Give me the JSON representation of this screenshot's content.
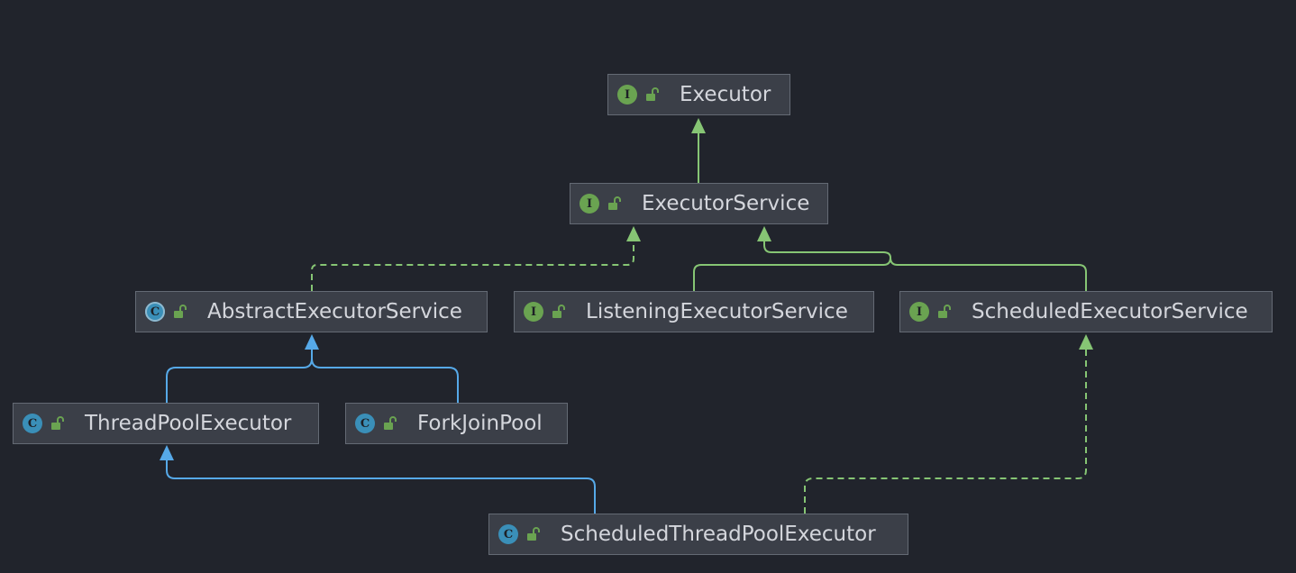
{
  "colors": {
    "background": "#21242c",
    "node_fill": "#3b3f48",
    "node_border": "#646a74",
    "text": "#d4d6dc",
    "interface_badge": "#6aa351",
    "class_badge": "#3a8fb8",
    "extends_arrow": "#56a9e8",
    "interface_arrow": "#86c574"
  },
  "nodes": {
    "executor": {
      "label": "Executor",
      "kind": "interface",
      "badge": "I"
    },
    "executor_service": {
      "label": "ExecutorService",
      "kind": "interface",
      "badge": "I"
    },
    "abstract_executor_service": {
      "label": "AbstractExecutorService",
      "kind": "abstract",
      "badge": "C"
    },
    "listening_executor_service": {
      "label": "ListeningExecutorService",
      "kind": "interface",
      "badge": "I"
    },
    "scheduled_executor_service": {
      "label": "ScheduledExecutorService",
      "kind": "interface",
      "badge": "I"
    },
    "thread_pool_executor": {
      "label": "ThreadPoolExecutor",
      "kind": "class",
      "badge": "C"
    },
    "fork_join_pool": {
      "label": "ForkJoinPool",
      "kind": "class",
      "badge": "C"
    },
    "scheduled_thread_pool_executor": {
      "label": "ScheduledThreadPoolExecutor",
      "kind": "class",
      "badge": "C"
    }
  },
  "edges": [
    {
      "from": "executor_service",
      "to": "executor",
      "type": "extends-interface"
    },
    {
      "from": "abstract_executor_service",
      "to": "executor_service",
      "type": "implements"
    },
    {
      "from": "listening_executor_service",
      "to": "executor_service",
      "type": "extends-interface"
    },
    {
      "from": "scheduled_executor_service",
      "to": "executor_service",
      "type": "extends-interface"
    },
    {
      "from": "thread_pool_executor",
      "to": "abstract_executor_service",
      "type": "extends"
    },
    {
      "from": "fork_join_pool",
      "to": "abstract_executor_service",
      "type": "extends"
    },
    {
      "from": "scheduled_thread_pool_executor",
      "to": "thread_pool_executor",
      "type": "extends"
    },
    {
      "from": "scheduled_thread_pool_executor",
      "to": "scheduled_executor_service",
      "type": "implements"
    }
  ]
}
